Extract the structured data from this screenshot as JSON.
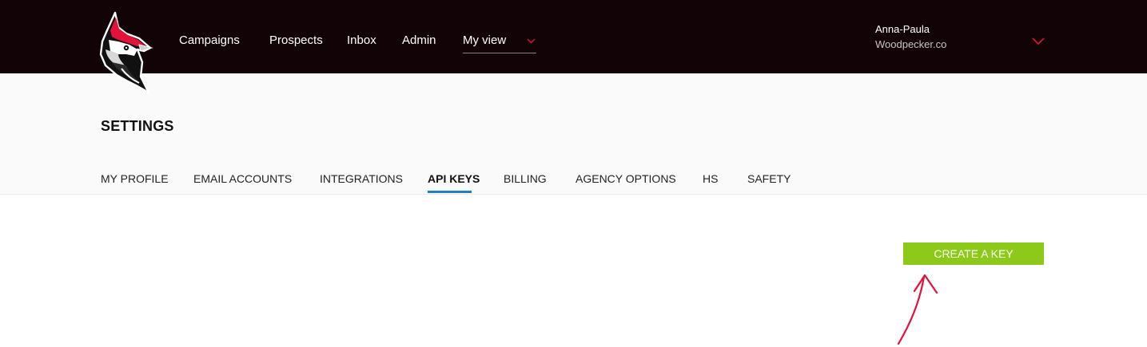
{
  "nav": {
    "items": [
      "Campaigns",
      "Prospects",
      "Inbox",
      "Admin"
    ],
    "myview_label": "My view"
  },
  "user": {
    "name": "Anna-Paula",
    "org": "Woodpecker.co"
  },
  "settings": {
    "title": "SETTINGS",
    "tabs": [
      "MY PROFILE",
      "EMAIL ACCOUNTS",
      "INTEGRATIONS",
      "API KEYS",
      "BILLING",
      "AGENCY OPTIONS",
      "HS",
      "SAFETY"
    ],
    "active_tab": "API KEYS"
  },
  "actions": {
    "create_key_label": "CREATE A KEY"
  },
  "colors": {
    "topbar": "#120406",
    "accent_red": "#e3123b",
    "tab_underline": "#1f7fc4",
    "button_green": "#8cc918"
  },
  "icons": {
    "logo": "woodpecker-logo-icon",
    "dropdown": "chevron-down-icon",
    "annotation": "arrow-up-icon"
  }
}
